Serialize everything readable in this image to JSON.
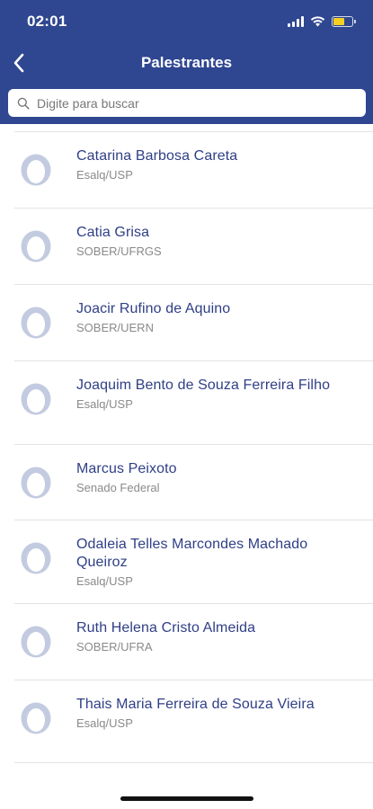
{
  "status_bar": {
    "time": "02:01",
    "icons": [
      "signal-icon",
      "wifi-icon",
      "battery-charging-icon"
    ]
  },
  "nav": {
    "title": "Palestrantes",
    "back_icon": "chevron-left-icon"
  },
  "search": {
    "placeholder": "Digite para buscar",
    "value": ""
  },
  "speakers": [
    {
      "name": "Catarina Barbosa Careta",
      "org": "Esalq/USP"
    },
    {
      "name": "Catia Grisa",
      "org": "SOBER/UFRGS"
    },
    {
      "name": "Joacir Rufino de Aquino",
      "org": "SOBER/UERN"
    },
    {
      "name": "Joaquim Bento de Souza Ferreira Filho",
      "org": "Esalq/USP"
    },
    {
      "name": "Marcus Peixoto",
      "org": "Senado Federal"
    },
    {
      "name": "Odaleia Telles Marcondes Machado Queiroz",
      "org": "Esalq/USP"
    },
    {
      "name": "Ruth Helena Cristo Almeida",
      "org": "SOBER/UFRA"
    },
    {
      "name": "Thais Maria Ferreira de Souza Vieira",
      "org": "Esalq/USP"
    }
  ],
  "colors": {
    "header": "#2f4690",
    "name_text": "#2f3f86",
    "avatar": "#c3cbe0"
  }
}
